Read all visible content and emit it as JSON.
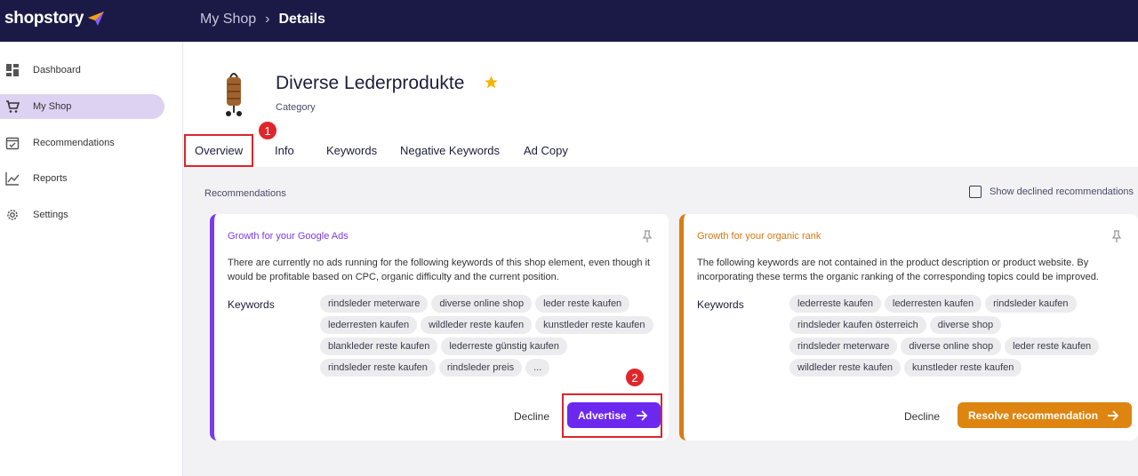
{
  "topbar": {
    "logo": "shopstory",
    "breadcrumb": [
      {
        "label": "My Shop"
      },
      {
        "label": "Details"
      }
    ]
  },
  "sidebar": {
    "items": [
      {
        "label": "Dashboard",
        "icon": "dashboard-icon"
      },
      {
        "label": "My Shop",
        "icon": "cart-icon",
        "active": true
      },
      {
        "label": "Recommendations",
        "icon": "calendar-check-icon"
      },
      {
        "label": "Reports",
        "icon": "chart-line-icon"
      },
      {
        "label": "Settings",
        "icon": "gear-icon"
      }
    ]
  },
  "product": {
    "title": "Diverse Lederprodukte",
    "subtitle": "Category",
    "favorite": true
  },
  "tabs": [
    {
      "label": "Overview",
      "active": true
    },
    {
      "label": "Info"
    },
    {
      "label": "Keywords"
    },
    {
      "label": "Negative Keywords"
    },
    {
      "label": "Ad Copy"
    }
  ],
  "annotations": {
    "badge1": "1",
    "badge2": "2"
  },
  "recommendations": {
    "label": "Recommendations",
    "show_declined": "Show declined recommendations",
    "cards": [
      {
        "title": "Growth for your Google Ads",
        "description": "There are currently no ads running for the following keywords of this shop element, even though it would be profitable based on CPC, organic difficulty and the current position.",
        "keywords_label": "Keywords",
        "keywords": [
          "rindsleder meterware",
          "diverse online shop",
          "leder reste kaufen",
          "lederresten kaufen",
          "wildleder reste kaufen",
          "kunstleder reste kaufen",
          "blankleder reste kaufen",
          "lederreste günstig kaufen",
          "rindsleder reste kaufen",
          "rindsleder preis",
          "..."
        ],
        "decline": "Decline",
        "action": "Advertise"
      },
      {
        "title": "Growth for your organic rank",
        "description": "The following keywords are not contained in the product description or product website. By incorporating these terms the organic ranking of the corresponding topics could be improved.",
        "keywords_label": "Keywords",
        "keywords": [
          "lederreste kaufen",
          "lederresten kaufen",
          "rindsleder kaufen",
          "rindsleder kaufen österreich",
          "diverse shop",
          "rindsleder meterware",
          "diverse online shop",
          "leder reste kaufen",
          "wildleder reste kaufen",
          "kunstleder reste kaufen"
        ],
        "decline": "Decline",
        "action": "Resolve recommendation"
      }
    ]
  },
  "colors": {
    "topbar": "#1b1a47",
    "purple": "#6d28f0",
    "orange": "#dd8510",
    "highlight": "#d9262c"
  }
}
